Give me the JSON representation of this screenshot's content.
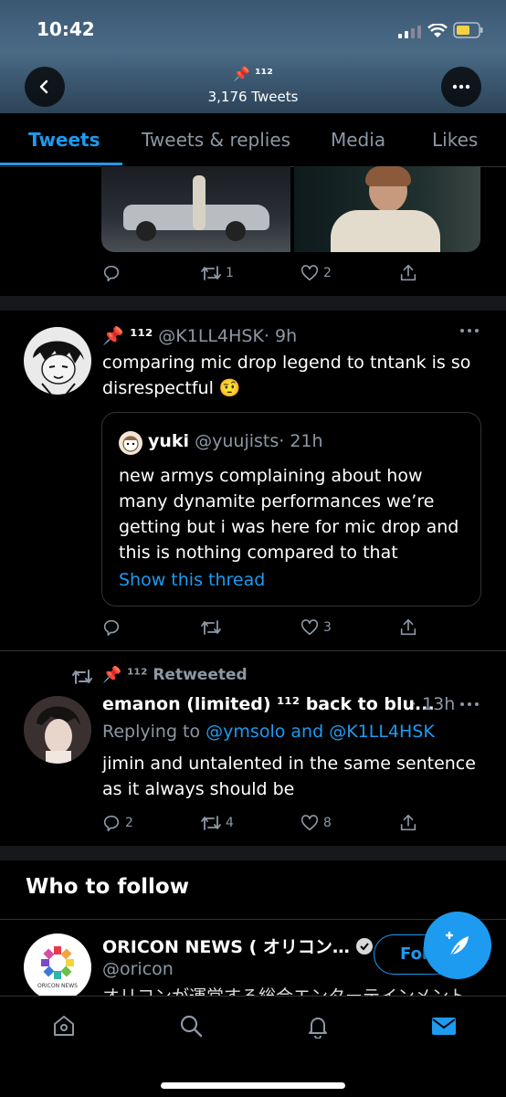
{
  "status_bar": {
    "time": "10:42"
  },
  "header": {
    "name": "📌 ¹¹²",
    "tweet_count": "3,176 Tweets"
  },
  "tabs": [
    "Tweets",
    "Tweets & replies",
    "Media",
    "Likes"
  ],
  "tweet1": {
    "actions": {
      "reply": "",
      "retweet": "1",
      "like": "2"
    }
  },
  "tweet2": {
    "display_name": "📌 ¹¹²",
    "handle": "@K1LL4HSK",
    "time": "· 9h",
    "text": "comparing mic drop legend to tntank is so disrespectful 🤨",
    "quote": {
      "name": "yuki",
      "handle": "@yuujists",
      "time": "· 21h",
      "text": "new armys complaining about how many dynamite performances we’re getting but i was here for mic drop and this is nothing compared to that",
      "show_thread": "Show this thread"
    },
    "actions": {
      "reply": "",
      "retweet": "",
      "like": "3"
    }
  },
  "tweet3": {
    "retweeted_by": "📌 ¹¹² Retweeted",
    "display_name": "emanon (limited) ¹¹² back to blu...",
    "time": "· 13h",
    "replying_prefix": "Replying to",
    "replying_to_1": "@ymsolo",
    "replying_and": "and",
    "replying_to_2": "@K1LL4HSK",
    "text": "jimin and untalented in the same sentence as it always should be",
    "actions": {
      "reply": "2",
      "retweet": "4",
      "like": "8"
    }
  },
  "who_to_follow": {
    "title": "Who to follow",
    "account": {
      "name": "ORICON NEWS ( オリコン…",
      "handle": "@oricon",
      "bio": "オリコンが運営する総合エンターテインメント",
      "follow_label": "Follow",
      "avatar_text": "ORICON NEWS"
    }
  },
  "colors": {
    "accent": "#1d9bf0",
    "muted": "#8b98a5",
    "background": "#000000",
    "header": "#3b5872"
  }
}
